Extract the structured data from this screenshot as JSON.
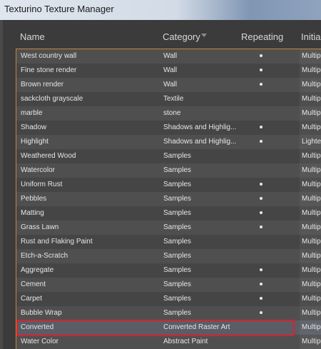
{
  "window": {
    "title": "Texturino Texture Manager"
  },
  "columns": {
    "name": "Name",
    "category": "Category",
    "repeating": "Repeating",
    "initial": "Initia"
  },
  "rows": [
    {
      "name": "West country wall",
      "category": "Wall",
      "repeating": true,
      "initial": "Multipl"
    },
    {
      "name": "Fine stone render",
      "category": "Wall",
      "repeating": true,
      "initial": "Multipl"
    },
    {
      "name": "Brown render",
      "category": "Wall",
      "repeating": true,
      "initial": "Multipl"
    },
    {
      "name": "sackcloth grayscale",
      "category": "Textile",
      "repeating": false,
      "initial": "Multipl"
    },
    {
      "name": "marble",
      "category": "stone",
      "repeating": false,
      "initial": "Multipl"
    },
    {
      "name": "Shadow",
      "category": "Shadows and Highlig...",
      "repeating": true,
      "initial": "Multipl"
    },
    {
      "name": "Highlight",
      "category": "Shadows and Highlig...",
      "repeating": true,
      "initial": "Lighter"
    },
    {
      "name": "Weathered Wood",
      "category": "Samples",
      "repeating": false,
      "initial": "Multipl"
    },
    {
      "name": "Watercolor",
      "category": "Samples",
      "repeating": false,
      "initial": "Multipl"
    },
    {
      "name": "Uniform Rust",
      "category": "Samples",
      "repeating": true,
      "initial": "Multipl"
    },
    {
      "name": "Pebbles",
      "category": "Samples",
      "repeating": true,
      "initial": "Multipl"
    },
    {
      "name": "Matting",
      "category": "Samples",
      "repeating": true,
      "initial": "Multipl"
    },
    {
      "name": "Grass Lawn",
      "category": "Samples",
      "repeating": true,
      "initial": "Multipl"
    },
    {
      "name": "Rust and Flaking Paint",
      "category": "Samples",
      "repeating": false,
      "initial": "Multipl"
    },
    {
      "name": "Etch-a-Scratch",
      "category": "Samples",
      "repeating": false,
      "initial": "Multipl"
    },
    {
      "name": "Aggregate",
      "category": "Samples",
      "repeating": true,
      "initial": "Multipl"
    },
    {
      "name": "Cement",
      "category": "Samples",
      "repeating": true,
      "initial": "Multipl"
    },
    {
      "name": "Carpet",
      "category": "Samples",
      "repeating": true,
      "initial": "Multipl"
    },
    {
      "name": "Bubble Wrap",
      "category": "Samples",
      "repeating": true,
      "initial": "Multipl"
    },
    {
      "name": "Converted",
      "category": "Converted Raster Art",
      "repeating": false,
      "initial": "Multipl",
      "selected": true
    },
    {
      "name": "Water Color",
      "category": "Abstract Paint",
      "repeating": false,
      "initial": "Multipl"
    }
  ],
  "colors": {
    "selection_outline": "#d8222b",
    "focus_border": "#c8843c"
  }
}
